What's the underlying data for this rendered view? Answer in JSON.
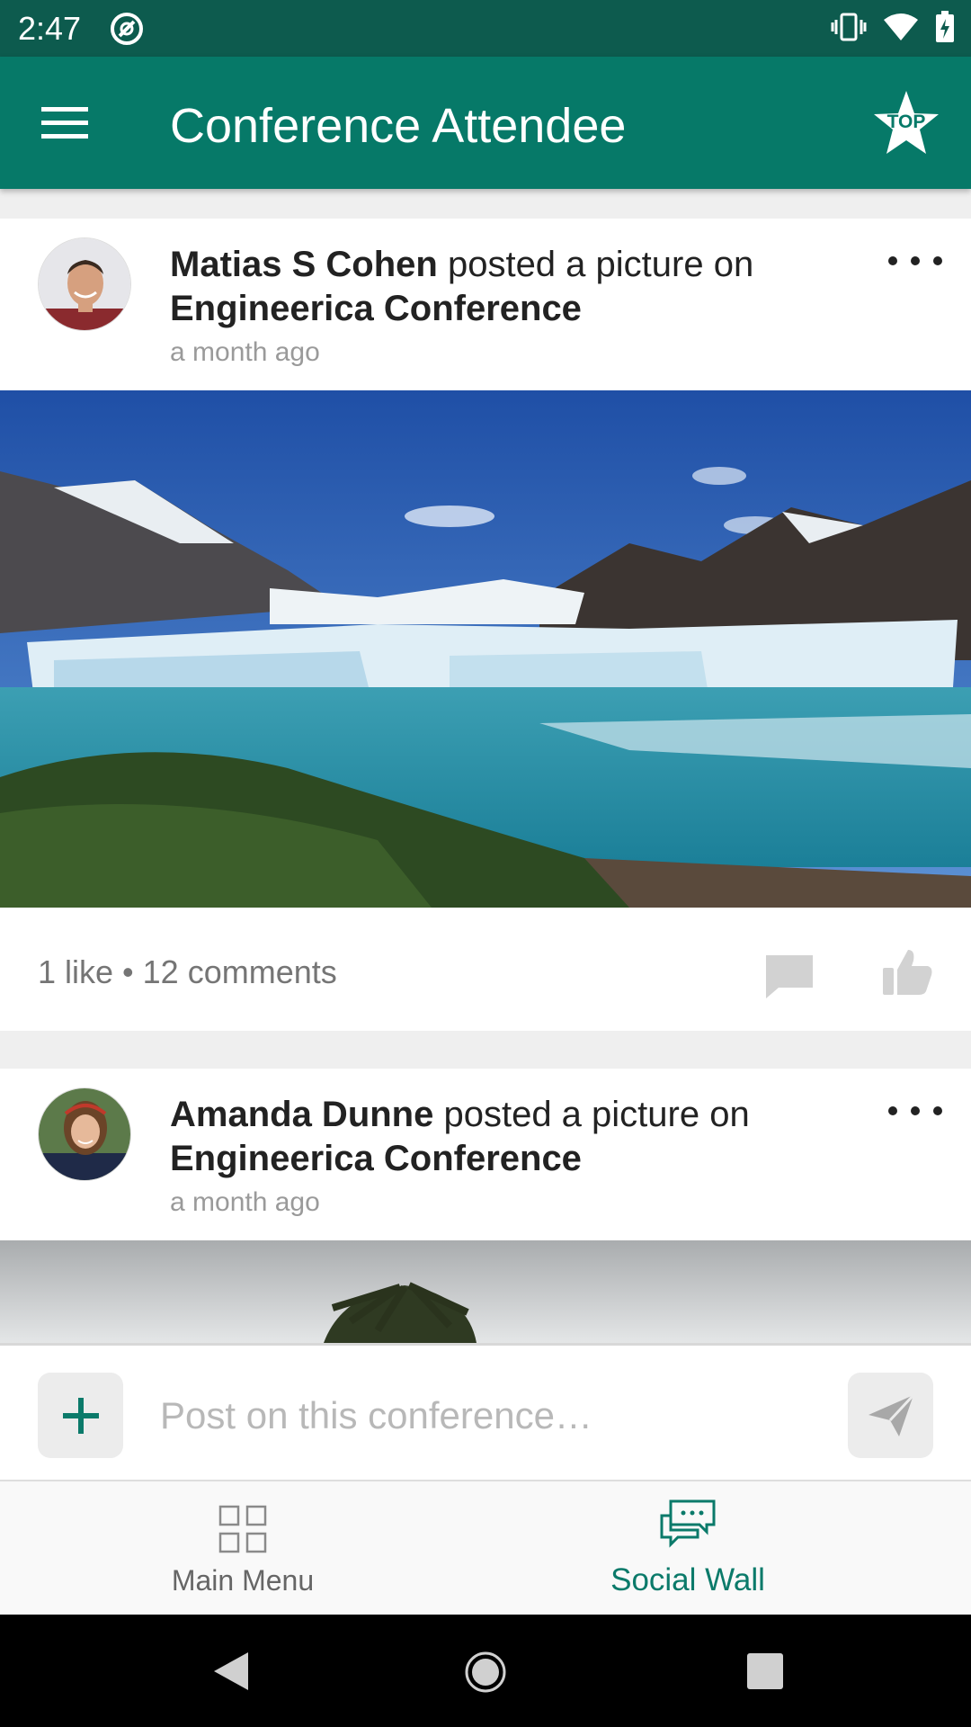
{
  "status_bar": {
    "time": "2:47",
    "icons": [
      "vibrate-icon",
      "wifi-icon",
      "battery-charging-icon"
    ]
  },
  "app_bar": {
    "title": "Conference Attendee",
    "menu_icon": "hamburger-menu-icon",
    "top_badge": "TOP"
  },
  "posts": [
    {
      "author": "Matias S Cohen",
      "action": " posted a picture on",
      "target": "Engineerica Conference",
      "time": "a month ago",
      "likes": "1 like",
      "separator": " • ",
      "comments": "12 comments",
      "photo": "glacier-landscape"
    },
    {
      "author": "Amanda Dunne",
      "action": " posted a picture on",
      "target": "Engineerica Conference",
      "time": "a month ago",
      "photo": "palm-tree-sky"
    }
  ],
  "composer": {
    "placeholder": "Post on this conference…",
    "add_icon": "plus-icon",
    "send_icon": "send-icon"
  },
  "bottom_nav": {
    "items": [
      {
        "label": "Main Menu",
        "icon": "grid-icon",
        "active": false
      },
      {
        "label": "Social Wall",
        "icon": "chat-bubbles-icon",
        "active": true
      }
    ]
  },
  "colors": {
    "status_bar": "#0d5b4e",
    "app_bar": "#067968",
    "accent": "#0b7a6a",
    "inactive": "#666666"
  }
}
